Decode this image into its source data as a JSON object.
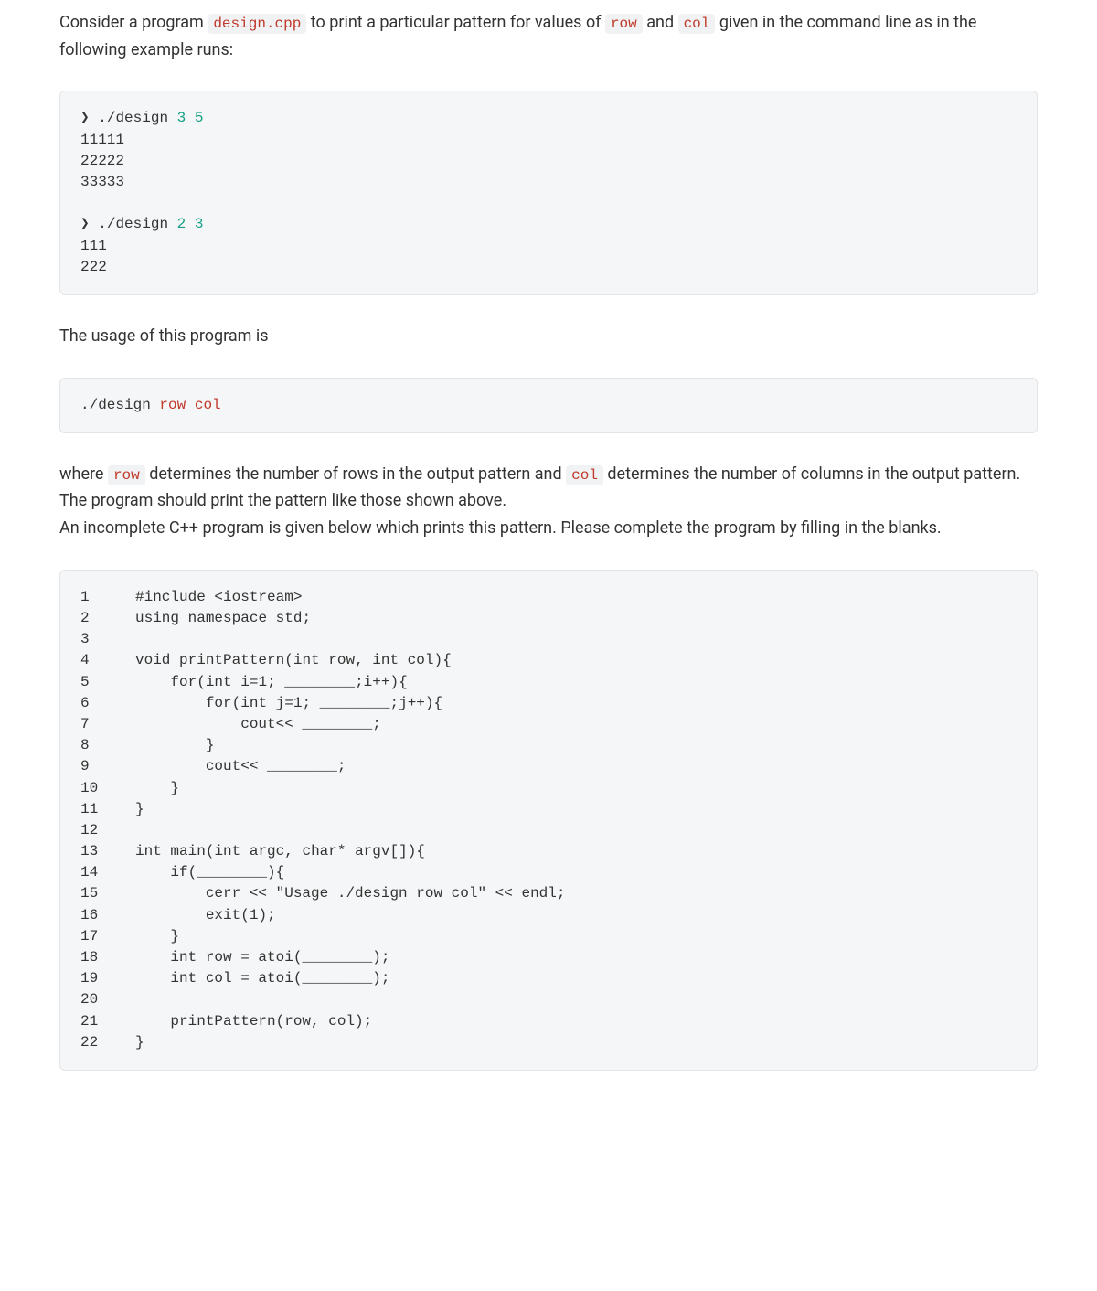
{
  "para1_part1": "Consider a program ",
  "para1_code1": "design.cpp",
  "para1_part2": " to print a particular pattern for values of ",
  "para1_code2": "row",
  "para1_part3": " and ",
  "para1_code3": "col",
  "para1_part4": " given in the command line as in the following example runs:",
  "codeblock1": {
    "l1p1": "❯ ./design ",
    "l1a": "3",
    "l1sp": " ",
    "l1b": "5",
    "l2": "11111",
    "l3": "22222",
    "l4": "33333",
    "l5": "",
    "l6p1": "❯ ./design ",
    "l6a": "2",
    "l6sp": " ",
    "l6b": "3",
    "l7": "111",
    "l8": "222"
  },
  "para2": "The usage of this program is",
  "codeblock2": {
    "p1": "./design ",
    "p2": "row",
    "p3": " ",
    "p4": "col"
  },
  "para3_part1": "where ",
  "para3_code1": "row",
  "para3_part2": " determines the number of rows in the output pattern and ",
  "para3_code2": "col",
  "para3_part3": " determines the number of columns in the output pattern. The program should print the pattern like those shown above.",
  "para4": "An incomplete C++ program is given below which prints this pattern. Please complete the program by filling in the blanks.",
  "code": {
    "lines": [
      {
        "n": "1",
        "segs": [
          {
            "t": "#include ",
            "c": "preproc"
          },
          {
            "t": "<iostream>",
            "c": "preproc"
          }
        ]
      },
      {
        "n": "2",
        "segs": [
          {
            "t": "using",
            "c": "kw"
          },
          {
            "t": " ",
            "c": ""
          },
          {
            "t": "namespace",
            "c": "kw"
          },
          {
            "t": " ",
            "c": ""
          },
          {
            "t": "std",
            "c": "fn"
          },
          {
            "t": ";",
            "c": ""
          }
        ]
      },
      {
        "n": "3",
        "segs": [
          {
            "t": "",
            "c": ""
          }
        ]
      },
      {
        "n": "4",
        "segs": [
          {
            "t": "void",
            "c": "kw"
          },
          {
            "t": " ",
            "c": ""
          },
          {
            "t": "printPattern",
            "c": "fn"
          },
          {
            "t": "(",
            "c": ""
          },
          {
            "t": "int",
            "c": "kw"
          },
          {
            "t": " row, ",
            "c": ""
          },
          {
            "t": "int",
            "c": "kw"
          },
          {
            "t": " col){",
            "c": ""
          }
        ]
      },
      {
        "n": "5",
        "segs": [
          {
            "t": "    ",
            "c": ""
          },
          {
            "t": "for",
            "c": "kw"
          },
          {
            "t": "(",
            "c": ""
          },
          {
            "t": "int",
            "c": "kw"
          },
          {
            "t": " i=",
            "c": ""
          },
          {
            "t": "1",
            "c": "num"
          },
          {
            "t": "; ________;i++){",
            "c": ""
          }
        ]
      },
      {
        "n": "6",
        "segs": [
          {
            "t": "        ",
            "c": ""
          },
          {
            "t": "for",
            "c": "kw"
          },
          {
            "t": "(",
            "c": ""
          },
          {
            "t": "int",
            "c": "kw"
          },
          {
            "t": " j=",
            "c": ""
          },
          {
            "t": "1",
            "c": "num"
          },
          {
            "t": "; ________;j++){",
            "c": ""
          }
        ]
      },
      {
        "n": "7",
        "segs": [
          {
            "t": "            cout<< ________;",
            "c": ""
          }
        ]
      },
      {
        "n": "8",
        "segs": [
          {
            "t": "        }",
            "c": ""
          }
        ]
      },
      {
        "n": "9",
        "segs": [
          {
            "t": "        cout<< ________;",
            "c": ""
          }
        ]
      },
      {
        "n": "10",
        "segs": [
          {
            "t": "    }",
            "c": ""
          }
        ]
      },
      {
        "n": "11",
        "segs": [
          {
            "t": "}",
            "c": ""
          }
        ]
      },
      {
        "n": "12",
        "segs": [
          {
            "t": "",
            "c": ""
          }
        ]
      },
      {
        "n": "13",
        "segs": [
          {
            "t": "int",
            "c": "kw"
          },
          {
            "t": " ",
            "c": ""
          },
          {
            "t": "main",
            "c": "fn"
          },
          {
            "t": "(",
            "c": ""
          },
          {
            "t": "int",
            "c": "kw"
          },
          {
            "t": " argc, ",
            "c": ""
          },
          {
            "t": "char",
            "c": "kw"
          },
          {
            "t": "* argv[]){",
            "c": ""
          }
        ]
      },
      {
        "n": "14",
        "segs": [
          {
            "t": "    ",
            "c": ""
          },
          {
            "t": "if",
            "c": "kw"
          },
          {
            "t": "(________){",
            "c": ""
          }
        ]
      },
      {
        "n": "15",
        "segs": [
          {
            "t": "        cerr << ",
            "c": ""
          },
          {
            "t": "\"Usage ./design row col\"",
            "c": "str"
          },
          {
            "t": " << endl;",
            "c": ""
          }
        ]
      },
      {
        "n": "16",
        "segs": [
          {
            "t": "        exit(",
            "c": ""
          },
          {
            "t": "1",
            "c": "num"
          },
          {
            "t": ");",
            "c": ""
          }
        ]
      },
      {
        "n": "17",
        "segs": [
          {
            "t": "    }",
            "c": ""
          }
        ]
      },
      {
        "n": "18",
        "segs": [
          {
            "t": "    ",
            "c": ""
          },
          {
            "t": "int",
            "c": "kw"
          },
          {
            "t": " row = atoi(________);",
            "c": ""
          }
        ]
      },
      {
        "n": "19",
        "segs": [
          {
            "t": "    ",
            "c": ""
          },
          {
            "t": "int",
            "c": "kw"
          },
          {
            "t": " col = atoi(________);",
            "c": ""
          }
        ]
      },
      {
        "n": "20",
        "segs": [
          {
            "t": "",
            "c": ""
          }
        ]
      },
      {
        "n": "21",
        "segs": [
          {
            "t": "    printPattern(row, col);",
            "c": ""
          }
        ]
      },
      {
        "n": "22",
        "segs": [
          {
            "t": "}",
            "c": ""
          }
        ]
      }
    ]
  }
}
